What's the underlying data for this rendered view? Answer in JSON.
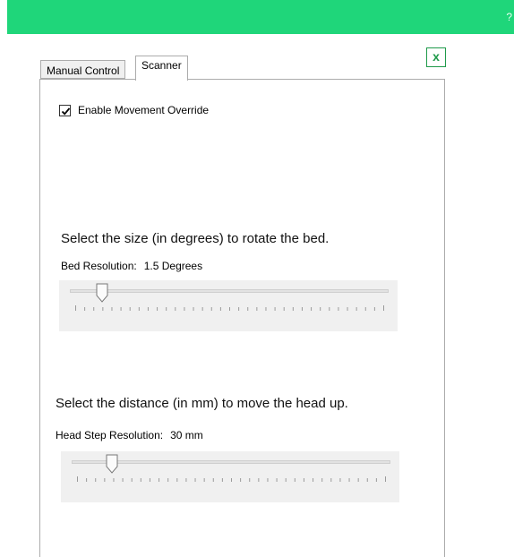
{
  "header": {
    "help_glyph": "?",
    "accent_color": "#1fd67a"
  },
  "close_button": {
    "label": "x"
  },
  "tabs": [
    {
      "label": "Manual Control",
      "active": false
    },
    {
      "label": "Scanner",
      "active": true
    }
  ],
  "override": {
    "label": "Enable Movement Override",
    "checked": true
  },
  "bed": {
    "heading": "Select the size (in degrees) to rotate the bed.",
    "label": "Bed Resolution:",
    "value": "1.5 Degrees",
    "slider_position": 0.1
  },
  "head": {
    "heading": "Select the distance (in mm) to move the head up.",
    "label": "Head Step Resolution:",
    "value": "30 mm",
    "slider_position": 0.125
  }
}
